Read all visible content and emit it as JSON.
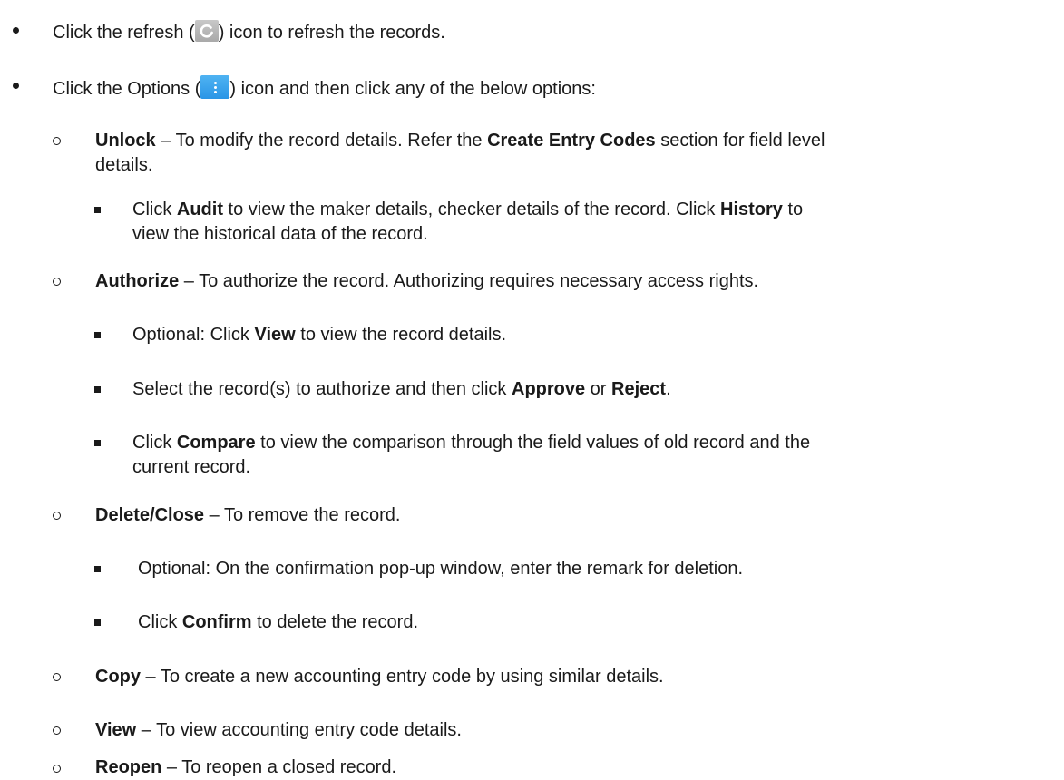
{
  "bullets": {
    "refresh": {
      "before": "Click the refresh (",
      "after": ") icon to refresh the records.",
      "icon": "refresh-icon"
    },
    "options": {
      "before": "Click the Options (",
      "after": ") icon and then click any of the below options:",
      "icon": "options-icon"
    }
  },
  "unlock": {
    "term": "Unlock",
    "text1": " – To modify the record details. Refer the ",
    "ref": "Create Entry Codes",
    "text2": " section for field level",
    "line2": "details.",
    "sub": {
      "a": "Click ",
      "audit": "Audit",
      "b": " to view the maker details, checker details of the record. Click ",
      "history": "History",
      "c": " to",
      "line2": "view the historical data of the record."
    }
  },
  "authorize": {
    "term": "Authorize",
    "text": " – To authorize the record. Authorizing requires necessary access rights.",
    "sub1": {
      "a": "Optional: Click ",
      "view": "View",
      "b": " to view the record details."
    },
    "sub2": {
      "a": "Select the record(s) to authorize and then click ",
      "approve": "Approve",
      "b": " or ",
      "reject": "Reject",
      "c": "."
    },
    "sub3": {
      "a": "Click ",
      "compare": "Compare",
      "b": " to view the comparison through the field values of old record and the",
      "line2": "current record."
    }
  },
  "delete": {
    "term": "Delete/Close",
    "text": " – To remove the record.",
    "sub1": "Optional: On the confirmation pop-up window, enter the remark for deletion.",
    "sub2": {
      "a": "Click ",
      "confirm": "Confirm",
      "b": " to delete the record."
    }
  },
  "copy": {
    "term": "Copy",
    "text": " – To create a new accounting entry code by using similar details."
  },
  "view": {
    "term": "View",
    "text": " – To view accounting entry code details."
  },
  "reopen": {
    "term": "Reopen",
    "text": " – To reopen a closed record."
  },
  "colors": {
    "refresh_icon": "#b5b5b5",
    "options_icon": "#3aa3ec",
    "text": "#1a1a1a"
  }
}
